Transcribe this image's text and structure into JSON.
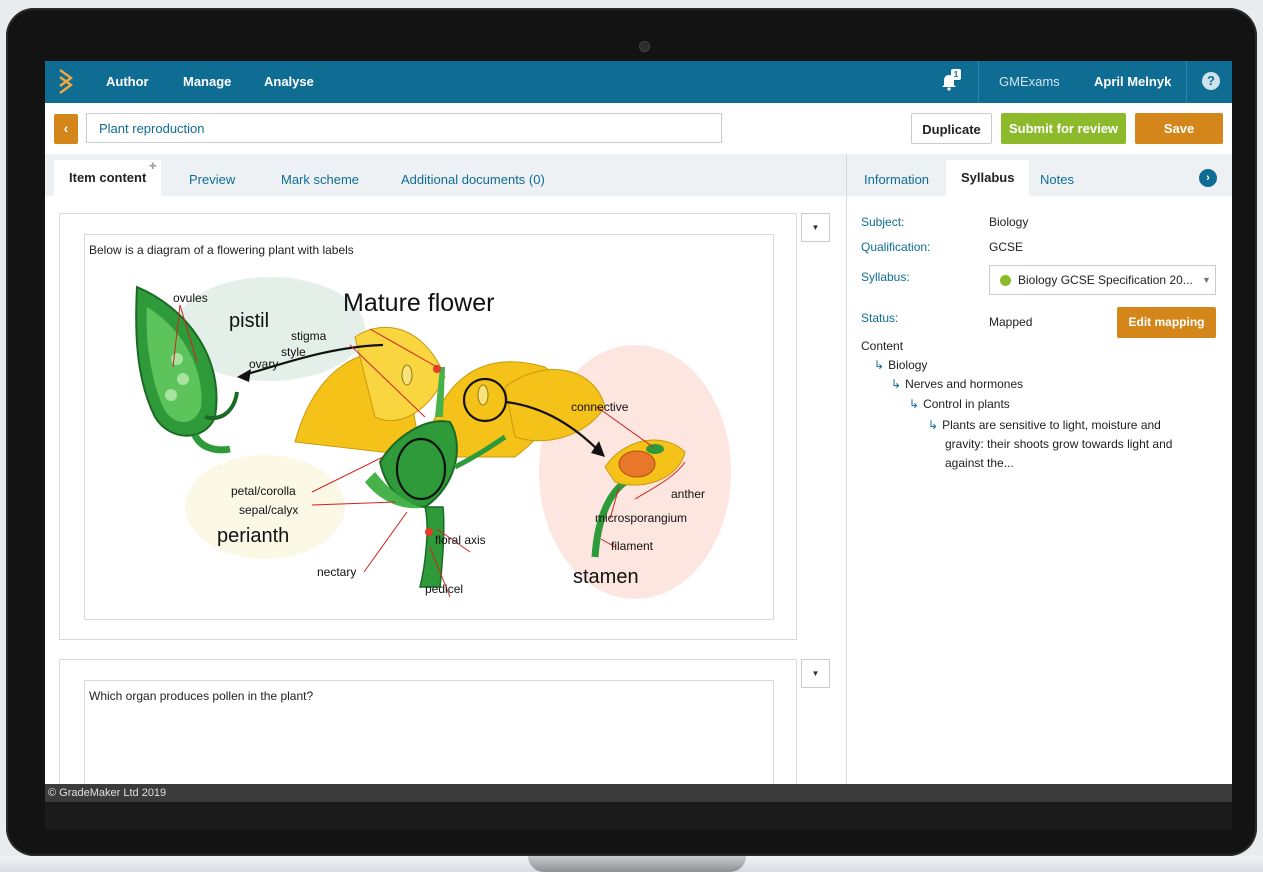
{
  "nav": {
    "items": [
      "Author",
      "Manage",
      "Analyse"
    ],
    "notification_count": "1",
    "org": "GMExams",
    "user": "April Melnyk",
    "help": "?"
  },
  "title_row": {
    "back_glyph": "‹",
    "title_value": "Plant reproduction",
    "duplicate_label": "Duplicate",
    "submit_label": "Submit for review",
    "save_label": "Save"
  },
  "tabs": {
    "left": [
      "Item content",
      "Preview",
      "Mark scheme",
      "Additional documents (0)"
    ],
    "right": [
      "Information",
      "Syllabus",
      "Notes"
    ]
  },
  "content": {
    "q1_text": "Below is a diagram of a flowering plant with labels",
    "q2_text": "Which organ produces pollen in the plant?",
    "diagram": {
      "title": "Mature flower",
      "labels": {
        "ovules": "ovules",
        "pistil": "pistil",
        "ovary": "ovary",
        "stigma": "stigma",
        "style": "style",
        "petal": "petal/corolla",
        "sepal": "sepal/calyx",
        "perianth": "perianth",
        "nectary": "nectary",
        "floral_axis": "floral axis",
        "pedicel": "pedicel",
        "connective": "connective",
        "anther": "anther",
        "microsporangium": "microsporangium",
        "filament": "filament",
        "stamen": "stamen"
      }
    }
  },
  "syllabus": {
    "subject_label": "Subject:",
    "subject_value": "Biology",
    "qualification_label": "Qualification:",
    "qualification_value": "GCSE",
    "syllabus_label": "Syllabus:",
    "syllabus_value": "Biology GCSE Specification 20...",
    "status_label": "Status:",
    "status_value": "Mapped",
    "edit_mapping_label": "Edit mapping",
    "content_heading": "Content",
    "tree": [
      "Biology",
      "Nerves and hormones",
      "Control in plants"
    ],
    "tree_leaf_line1": "Plants are sensitive to light, moisture and",
    "tree_leaf_line2": "gravity: their shoots grow towards light and",
    "tree_leaf_line3": "against the..."
  },
  "footer": {
    "copyright": "© GradeMaker Ltd 2019"
  },
  "colors": {
    "brand": "#0f6d94",
    "accent_orange": "#d4861a",
    "accent_green": "#8dba2b"
  }
}
